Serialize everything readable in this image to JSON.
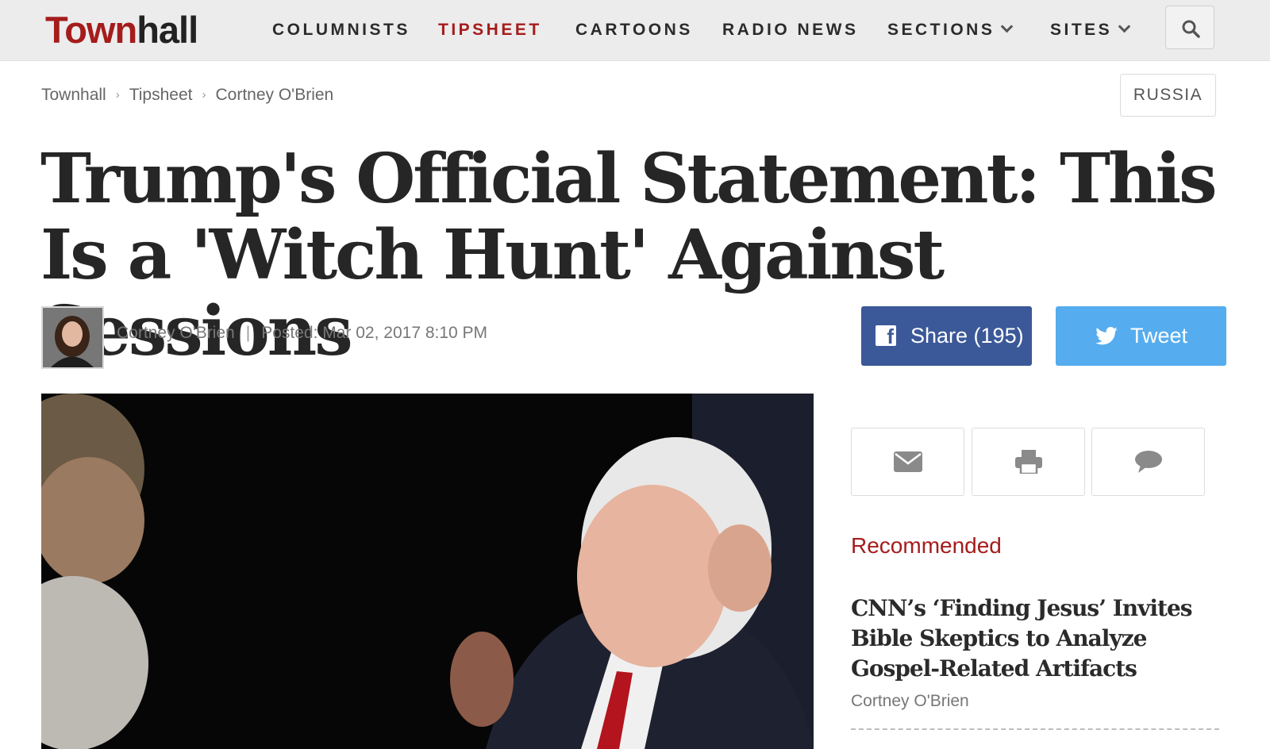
{
  "site": {
    "logo_part1": "Town",
    "logo_part2": "hall",
    "brand_color": "#a51c1c"
  },
  "nav": {
    "items": [
      {
        "label": "COLUMNISTS",
        "active": false
      },
      {
        "label": "TIPSHEET",
        "active": true
      },
      {
        "label": "CARTOONS",
        "active": false
      },
      {
        "label": "RADIO NEWS",
        "active": false
      },
      {
        "label": "SECTIONS",
        "dropdown": true
      },
      {
        "label": "SITES",
        "dropdown": true
      }
    ],
    "search_icon": "search-icon"
  },
  "breadcrumb": {
    "items": [
      "Townhall",
      "Tipsheet",
      "Cortney O'Brien"
    ],
    "separator": "›"
  },
  "tag": "RUSSIA",
  "article": {
    "headline_line1": "Trump's Official Statement: This",
    "headline_line2": "Is a 'Witch Hunt' Against Sessions",
    "author": "Cortney O'Brien",
    "separator": "|",
    "posted": "Posted: Mar 02, 2017 8:10 PM"
  },
  "social": {
    "share_label": "Share (195)",
    "share_color": "#3b5898",
    "tweet_label": "Tweet",
    "tweet_color": "#55acee"
  },
  "tools": [
    "email-icon",
    "print-icon",
    "comment-icon"
  ],
  "recommended": {
    "heading": "Recommended",
    "items": [
      {
        "title": "CNN’s ‘Finding Jesus’ Invites Bible Skeptics to Analyze Gospel-Related Artifacts",
        "author": "Cortney O'Brien"
      }
    ]
  }
}
